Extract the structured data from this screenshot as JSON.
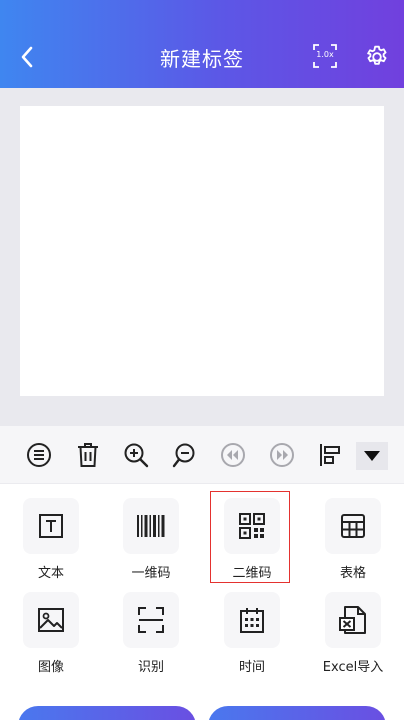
{
  "header": {
    "title": "新建标签",
    "zoom_label": "1.0x"
  },
  "grid": {
    "items": [
      {
        "label": "文本"
      },
      {
        "label": "一维码"
      },
      {
        "label": "二维码"
      },
      {
        "label": "表格"
      },
      {
        "label": "图像"
      },
      {
        "label": "识别"
      },
      {
        "label": "时间"
      },
      {
        "label": "Excel导入"
      }
    ]
  },
  "colors": {
    "header_gradient_start": "#3f86f0",
    "header_gradient_end": "#7140de",
    "canvas_bg": "#e9e9ee",
    "highlight_border": "#e4322f"
  }
}
